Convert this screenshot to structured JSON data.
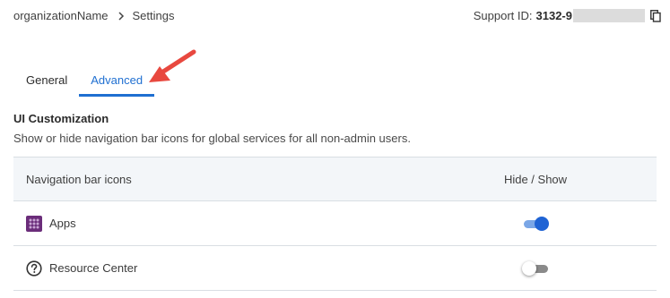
{
  "breadcrumb": {
    "org": "organizationName",
    "current": "Settings"
  },
  "support": {
    "label": "Support ID:",
    "value": "3132-9"
  },
  "tabs": [
    {
      "label": "General",
      "active": false
    },
    {
      "label": "Advanced",
      "active": true
    }
  ],
  "section": {
    "title": "UI Customization",
    "description": "Show or hide navigation bar icons for global services for all non-admin users."
  },
  "table": {
    "headers": [
      "Navigation bar icons",
      "Hide / Show"
    ],
    "rows": [
      {
        "label": "Apps",
        "icon": "apps-icon",
        "enabled": true
      },
      {
        "label": "Resource Center",
        "icon": "question-circle-icon",
        "enabled": false
      }
    ]
  },
  "colors": {
    "accent": "#1f6fd1",
    "annotation_arrow": "#e8483f",
    "apps_icon_bg": "#6b2d7a"
  }
}
